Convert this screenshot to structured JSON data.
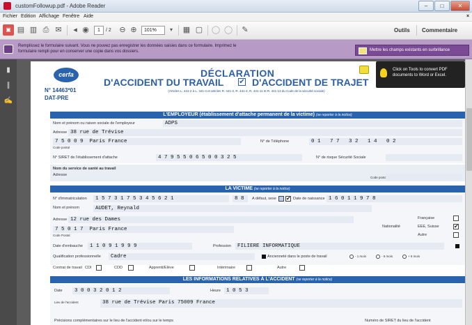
{
  "window": {
    "title": "customFollowup.pdf - Adobe Reader",
    "min": "–",
    "max": "□",
    "close": "✕"
  },
  "menu": [
    "Fichier",
    "Edition",
    "Affichage",
    "Fenêtre",
    "Aide"
  ],
  "toolbar": {
    "page_current": "1",
    "page_total": "/ 2",
    "zoom": "101%",
    "tools_label": "Outils",
    "comment_label": "Commentaire"
  },
  "formbar": {
    "message": "Remplissez le formulaire suivant. Vous ne pouvez pas enregistrer les données saisies dans ce formulaire. Imprimez le formulaire rempli pour en conserver une copie dans vos dossiers.",
    "highlight_button": "Mettre les champs existants en surbrillance"
  },
  "tooltip": "Click on Tools to convert PDF documents to Word or Excel.",
  "doc": {
    "logo": "cerfa",
    "form_number": "N° 14463*01",
    "form_code": "DAT-PRE",
    "title_line1": "DÉCLARATION",
    "title_at": "D'ACCIDENT DU TRAVAIL",
    "title_trajet": "D'ACCIDENT DE TRAJET",
    "checked": "✔",
    "legal": "(Articles L. 441-2 à L. 441-4 et articles R. 441-3, R. 441-4, R. 441-11 et R. 441-13 du Code de la sécurité sociale)",
    "section1": {
      "title": "L'EMPLOYEUR (établissement d'attache permanent de la victime)",
      "note": "(se reporter à la notice)",
      "name_label": "Nom et prénom ou raison sociale de l'employeur",
      "name_value": "ADPS",
      "address_label": "Adresse",
      "address_value": "38 rue de Trévise",
      "city_value": "7 5 0 0 9  Paris France",
      "postcode_label": "Code postal",
      "phone_label": "N° de Téléphone",
      "phone_value": "0 1   7 7   3 2   1 4   0 2",
      "siret_label": "N° SIRET de l'établissement d'attache",
      "siret_value": "4 7 9 5 5 0 6 5 0 0 3 2 5",
      "risk_label": "N° de risque Sécurité Sociale",
      "health_label": "Nom du service de santé au travail",
      "health_addr_label": "Adresse",
      "health_pc_label": "Code postal"
    },
    "section2": {
      "title": "LA VICTIME",
      "note": "(se reporter à la notice)",
      "ssn_label": "N° d'immatriculation",
      "ssn_value": "1 5 7 3 1 7 5 3 4 5 6 2 1",
      "ssn_key": "8 8",
      "foreign_label": "A défaut, sexe",
      "birth_label": "Date de naissance",
      "birth_value": "1 6 0 1 1 9 7 8",
      "name_label": "Nom et prénom",
      "name_value": "AUDET, Reynald",
      "address_label": "Adresse",
      "address_value": "12 rue des Dames",
      "city_value": "7 5 0 1 7  Paris France",
      "postcode_label": "Code Postal",
      "nat_label": "Nationalité",
      "nat_fr": "Française",
      "nat_eee": "EEE, Suisse",
      "nat_other": "Autre",
      "hire_label": "Date d'embauche",
      "hire_value": "1 1 0 9 1 9 9 9",
      "profession_label": "Profession",
      "profession_value": "FILIERE INFORMATIQUE",
      "qualif_label": "Qualification professionnelle",
      "qualif_value": "Cadre",
      "seniority_label": "Ancienneté dans le poste de travail",
      "seniority_opts": [
        "- 1 mois",
        "- 6 mois",
        "+ 6 mois"
      ],
      "contract_label": "Contrat de travail",
      "contracts": [
        "CDI",
        "CDD",
        "Apprenti/Elève",
        "Intérimaire",
        "Autre"
      ]
    },
    "section3": {
      "title": "LES INFORMATIONS RELATIVES À L'ACCIDENT",
      "note": "(se reporter à la notice)",
      "date_label": "Date",
      "date_value": "3 0 0 3 2 0 1 2",
      "time_label": "Heure",
      "time_value": "1 0 5 3",
      "place_label": "Lieu de l'accident",
      "place_value": "38 rue de Trévise Paris 75009 France",
      "details_label": "Précisions complémentaires sur le lieu de l'accident et/ou sur le temps",
      "siret_label": "Numéro de SIRET du lieu de l'accident"
    }
  }
}
